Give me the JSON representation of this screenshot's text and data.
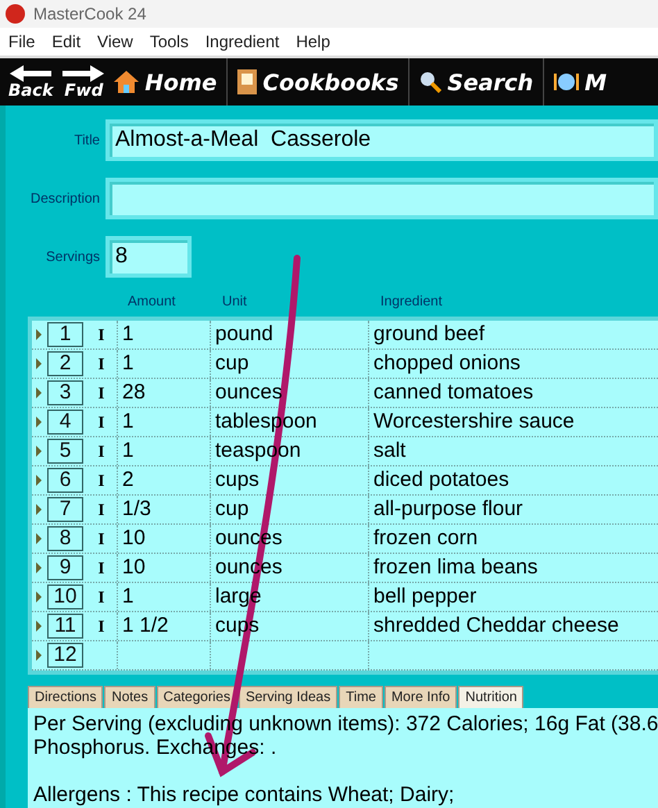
{
  "window": {
    "title": "MasterCook 24"
  },
  "menu": [
    "File",
    "Edit",
    "View",
    "Tools",
    "Ingredient",
    "Help"
  ],
  "toolbar": [
    {
      "label": "Back",
      "kind": "back"
    },
    {
      "label": "Fwd",
      "kind": "fwd"
    },
    {
      "label": "Home",
      "kind": "home"
    },
    {
      "label": "Cookbooks",
      "kind": "book"
    },
    {
      "label": "Search",
      "kind": "search"
    },
    {
      "label": "M",
      "kind": "plate"
    }
  ],
  "form": {
    "title": {
      "label": "Title",
      "value": "Almost-a-Meal  Casserole"
    },
    "description": {
      "label": "Description"
    },
    "servings": {
      "label": "Servings",
      "value": "8"
    }
  },
  "ingredients": {
    "columns": [
      "Amount",
      "Unit",
      "Ingredient"
    ],
    "rows": [
      {
        "number": "1",
        "marker": "I",
        "amount": "1",
        "unit": "pound",
        "ingredient": "ground beef"
      },
      {
        "number": "2",
        "marker": "I",
        "amount": "1",
        "unit": "cup",
        "ingredient": "chopped onions"
      },
      {
        "number": "3",
        "marker": "I",
        "amount": "28",
        "unit": "ounces",
        "ingredient": "canned tomatoes"
      },
      {
        "number": "4",
        "marker": "I",
        "amount": "1",
        "unit": "tablespoon",
        "ingredient": "Worcestershire sauce"
      },
      {
        "number": "5",
        "marker": "I",
        "amount": "1",
        "unit": "teaspoon",
        "ingredient": "salt"
      },
      {
        "number": "6",
        "marker": "I",
        "amount": "2",
        "unit": "cups",
        "ingredient": "diced potatoes"
      },
      {
        "number": "7",
        "marker": "I",
        "amount": "1/3",
        "unit": "cup",
        "ingredient": "all-purpose flour"
      },
      {
        "number": "8",
        "marker": "I",
        "amount": "10",
        "unit": "ounces",
        "ingredient": "frozen corn"
      },
      {
        "number": "9",
        "marker": "I",
        "amount": "10",
        "unit": "ounces",
        "ingredient": "frozen lima beans"
      },
      {
        "number": "10",
        "marker": "I",
        "amount": "1",
        "unit": "large",
        "ingredient": "bell pepper"
      },
      {
        "number": "11",
        "marker": "I",
        "amount": "1 1/2",
        "unit": "cups",
        "ingredient": "shredded Cheddar cheese"
      },
      {
        "number": "12"
      }
    ]
  },
  "tabs": [
    {
      "label": "Directions",
      "selected": false
    },
    {
      "label": "Notes",
      "selected": false
    },
    {
      "label": "Categories",
      "selected": false
    },
    {
      "label": "Serving Ideas",
      "selected": false
    },
    {
      "label": "Time",
      "selected": false
    },
    {
      "label": "More Info",
      "selected": false
    },
    {
      "label": "Nutrition",
      "selected": true
    }
  ],
  "nutrition": {
    "lines": [
      "Per Serving (excluding unknown items): 372 Calories; 16g Fat (38.6",
      "Phosphorus.  Exchanges: ."
    ],
    "allergens": "Allergens : This recipe contains Wheat; Dairy;"
  }
}
